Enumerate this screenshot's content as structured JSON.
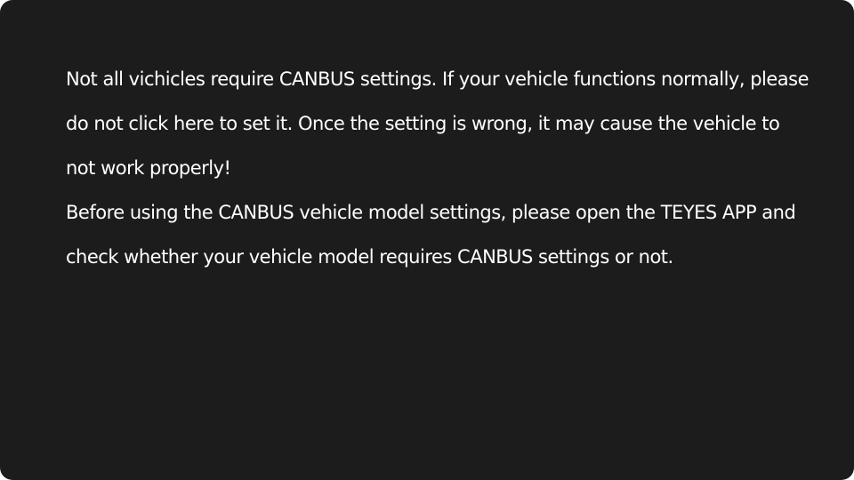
{
  "notice": {
    "warning_text": "Not all vichicles require CANBUS settings. If your vehicle functions normally, please do not click here to set it. Once the setting is wrong, it may cause the vehicle to not work properly!",
    "instruction_text": "Before using the CANBUS vehicle model settings, please open the TEYES APP and check whether your vehicle model requires CANBUS settings or not."
  }
}
